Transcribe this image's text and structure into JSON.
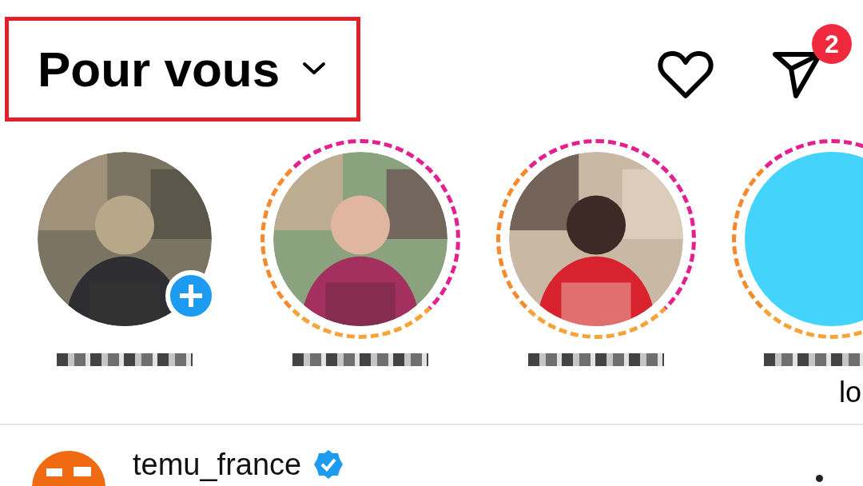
{
  "header": {
    "title": "Pour vous",
    "highlighted": true,
    "notifications_badge": "2"
  },
  "stories": [
    {
      "kind": "own",
      "ring": false,
      "add_badge": true
    },
    {
      "kind": "picture",
      "ring": true,
      "add_badge": false
    },
    {
      "kind": "picture",
      "ring": true,
      "add_badge": false
    },
    {
      "kind": "flat",
      "ring": true,
      "add_badge": false
    }
  ],
  "cut_text": "lo",
  "post": {
    "username": "temu_france",
    "verified": true
  }
}
